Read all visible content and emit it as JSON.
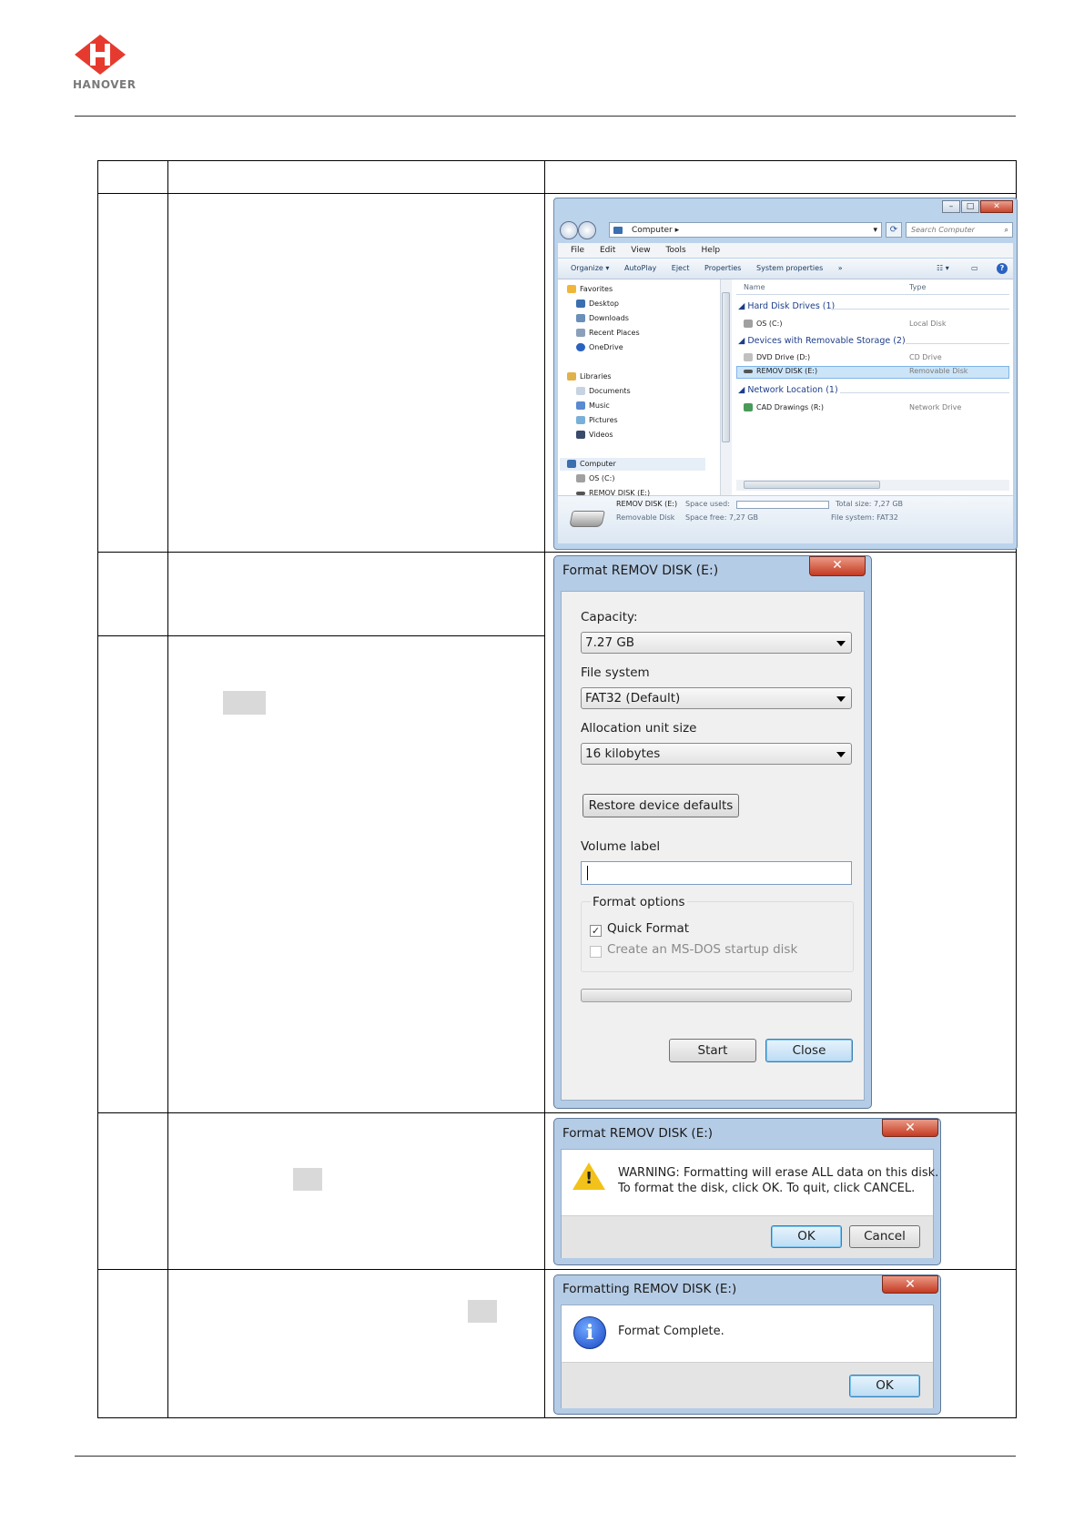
{
  "logo": {
    "text": "HANOVER",
    "color": "#e63a2e"
  },
  "explorer": {
    "address": "Computer",
    "search_placeholder": "Search Computer",
    "menu": [
      "File",
      "Edit",
      "View",
      "Tools",
      "Help"
    ],
    "toolbar": [
      "Organize ▾",
      "AutoPlay",
      "Eject",
      "Properties",
      "System properties",
      "»"
    ],
    "nav": {
      "favorites": "Favorites",
      "desktop": "Desktop",
      "downloads": "Downloads",
      "recent": "Recent Places",
      "onedrive": "OneDrive",
      "libraries": "Libraries",
      "documents": "Documents",
      "music": "Music",
      "pictures": "Pictures",
      "videos": "Videos",
      "computer": "Computer",
      "os": "OS (C:)",
      "remov": "REMOV DISK (E:)"
    },
    "columns": {
      "name": "Name",
      "type": "Type"
    },
    "groups": {
      "hdd": "Hard Disk Drives (1)",
      "removable": "Devices with Removable Storage (2)",
      "network": "Network Location (1)"
    },
    "items": {
      "os_name": "OS (C:)",
      "os_type": "Local Disk",
      "dvd_name": "DVD Drive (D:)",
      "dvd_type": "CD Drive",
      "remov_name": "REMOV DISK (E:)",
      "remov_type": "Removable Disk",
      "cad_name": "CAD Drawings (R:)",
      "cad_type": "Network Drive"
    },
    "details": {
      "name": "REMOV DISK (E:)",
      "kind": "Removable Disk",
      "space_used_label": "Space used:",
      "space_free": "Space free: 7,27 GB",
      "total_size": "Total size: 7,27 GB",
      "file_system": "File system: FAT32"
    }
  },
  "format_dialog": {
    "title": "Format REMOV DISK (E:)",
    "capacity_label": "Capacity:",
    "capacity_value": "7.27 GB",
    "fs_label": "File system",
    "fs_value": "FAT32 (Default)",
    "alloc_label": "Allocation unit size",
    "alloc_value": "16 kilobytes",
    "restore_button": "Restore device defaults",
    "volume_label": "Volume label",
    "format_options": "Format options",
    "quick_format": "Quick Format",
    "msdos": "Create an MS-DOS startup disk",
    "start_button": "Start",
    "close_button": "Close"
  },
  "warning_dialog": {
    "title": "Format REMOV DISK (E:)",
    "line1": "WARNING: Formatting will erase ALL data on this disk.",
    "line2": "To format the disk, click OK. To quit, click CANCEL.",
    "ok_button": "OK",
    "cancel_button": "Cancel"
  },
  "complete_dialog": {
    "title": "Formatting REMOV DISK (E:)",
    "message": "Format Complete.",
    "ok_button": "OK"
  }
}
